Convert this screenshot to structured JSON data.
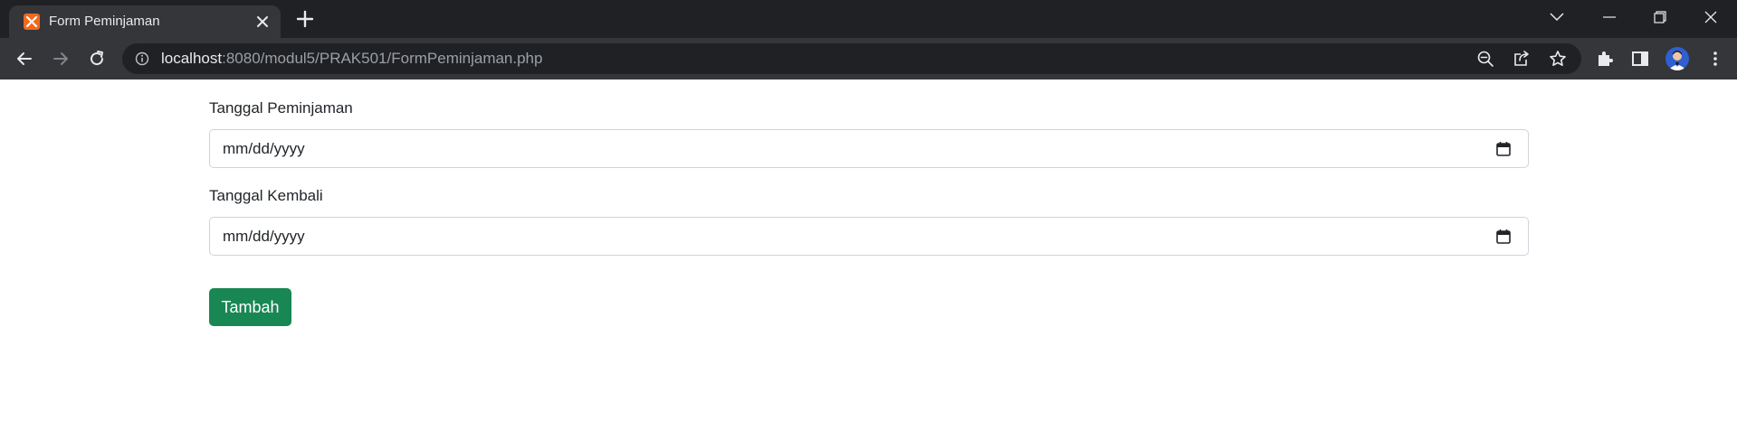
{
  "browser": {
    "tab": {
      "title": "Form Peminjaman",
      "favicon": "xampp-icon"
    },
    "address_bar": {
      "host": "localhost",
      "path": ":8080/modul5/PRAK501/FormPeminjaman.php"
    }
  },
  "form": {
    "tanggal_peminjaman": {
      "label": "Tanggal Peminjaman",
      "placeholder": "mm/dd/yyyy"
    },
    "tanggal_kembali": {
      "label": "Tanggal Kembali",
      "placeholder": "mm/dd/yyyy"
    },
    "submit_label": "Tambah"
  },
  "colors": {
    "tabstrip_bg": "#202124",
    "toolbar_bg": "#35363a",
    "button_success": "#198754",
    "favicon": "#f06a1e"
  }
}
